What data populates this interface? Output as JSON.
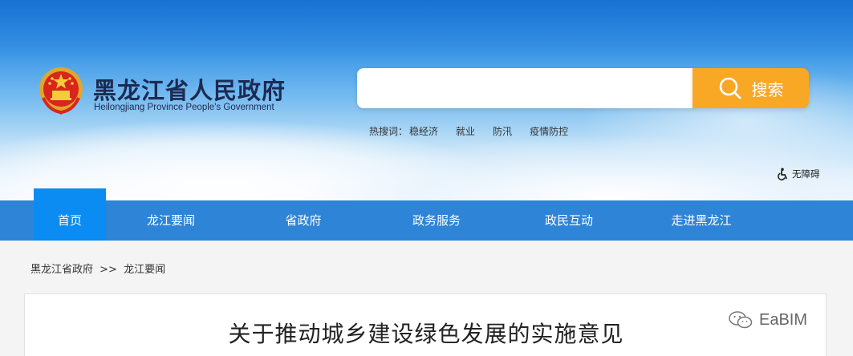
{
  "header": {
    "title": "黑龙江省人民政府",
    "subtitle": "Heilongjiang Province People's Government"
  },
  "search": {
    "placeholder": "",
    "button_label": "搜索",
    "icon": "search-icon"
  },
  "hot_search": {
    "label": "热搜词：",
    "items": [
      "稳经济",
      "就业",
      "防汛",
      "疫情防控"
    ]
  },
  "accessibility": {
    "label": "无障碍",
    "icon": "accessibility-icon"
  },
  "nav": {
    "items": [
      {
        "label": "首页",
        "active": true
      },
      {
        "label": "龙江要闻",
        "active": false
      },
      {
        "label": "省政府",
        "active": false
      },
      {
        "label": "政务服务",
        "active": false
      },
      {
        "label": "政民互动",
        "active": false
      },
      {
        "label": "走进黑龙江",
        "active": false
      }
    ]
  },
  "breadcrumb": {
    "items": [
      "黑龙江省政府",
      ">>",
      "龙江要闻"
    ]
  },
  "article": {
    "title": "关于推动城乡建设绿色发展的实施意见"
  },
  "watermark": {
    "text": "EaBIM",
    "icon": "wechat-icon"
  },
  "colors": {
    "nav_bg": "#2e84d6",
    "nav_active": "#0a8cf2",
    "search_button": "#f8a825",
    "title_text": "#1c2a52"
  }
}
